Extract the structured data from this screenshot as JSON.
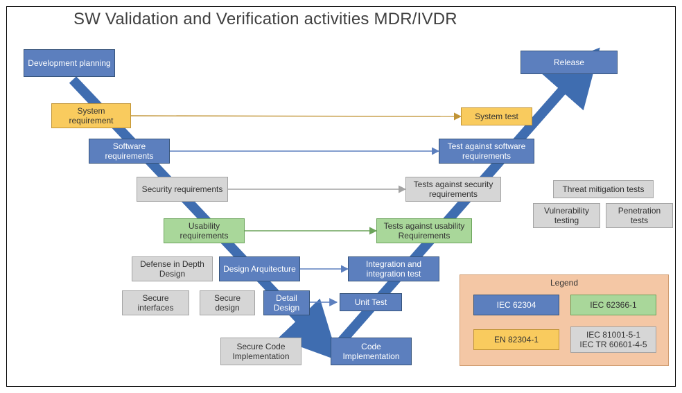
{
  "title": "SW Validation and Verification activities MDR/IVDR",
  "nodes": {
    "devplan": "Development planning",
    "sysreq": "System requirement",
    "swreq": "Software requirements",
    "secreq": "Security requirements",
    "usareq": "Usability requirements",
    "defdepth": "Defense in Depth Design",
    "designarch": "Design Arquitecture",
    "secint": "Secure interfaces",
    "secdes": "Secure design",
    "detdesign": "Detail Design",
    "unittest": "Unit Test",
    "seccode": "Secure Code Implementation",
    "codeimpl": "Code Implementation",
    "inttest": "Integration and integration test",
    "usatest": "Tests against usability Requirements",
    "sectest": "Tests against security requirements",
    "swtest": "Test against software requirements",
    "systest": "System test",
    "release": "Release",
    "threat": "Threat mitigation tests",
    "vuln": "Vulnerability testing",
    "pentest": "Penetration tests"
  },
  "legend": {
    "title": "Legend",
    "iec62304": "IEC 62304",
    "iec62366": "IEC 62366-1",
    "en82304": "EN 82304-1",
    "iec81001": "IEC 81001-5-1\nIEC TR 60601-4-5"
  },
  "edges": [
    {
      "from": "sysreq",
      "to": "systest",
      "color": "#c19436"
    },
    {
      "from": "swreq",
      "to": "swtest",
      "color": "#5c7fbe"
    },
    {
      "from": "secreq",
      "to": "sectest",
      "color": "#a3a3a3"
    },
    {
      "from": "usareq",
      "to": "usatest",
      "color": "#6ba35a"
    },
    {
      "from": "designarch",
      "to": "inttest",
      "color": "#5c7fbe"
    }
  ]
}
